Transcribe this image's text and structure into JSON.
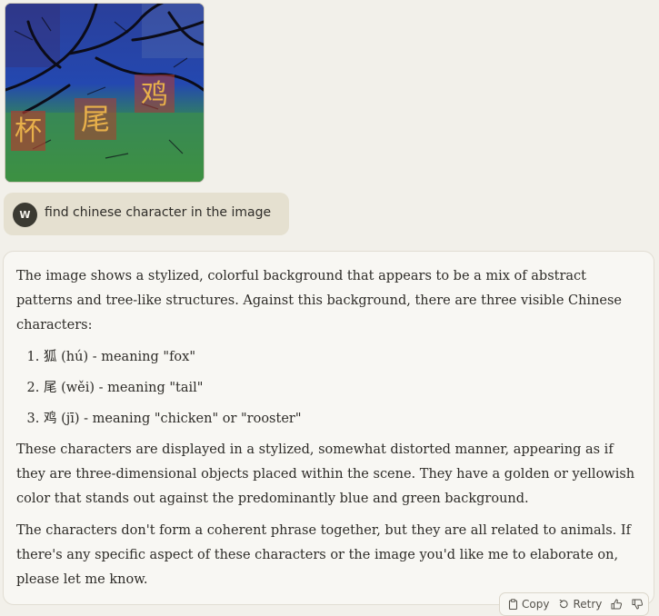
{
  "attachment": {
    "characters": [
      "杯",
      "尾",
      "鸡"
    ]
  },
  "user": {
    "avatar_initial": "W",
    "message": "find chinese character in the image"
  },
  "assistant": {
    "p1": "The image shows a stylized, colorful background that appears to be a mix of abstract patterns and tree-like structures. Against this background, there are three visible Chinese characters:",
    "list": [
      "狐 (hú) - meaning \"fox\"",
      "尾 (wěi) - meaning \"tail\"",
      "鸡 (jī) - meaning \"chicken\" or \"rooster\""
    ],
    "p2": "These characters are displayed in a stylized, somewhat distorted manner, appearing as if they are three-dimensional objects placed within the scene. They have a golden or yellowish color that stands out against the predominantly blue and green background.",
    "p3": "The characters don't form a coherent phrase together, but they are all related to animals. If there's any specific aspect of these characters or the image you'd like me to elaborate on, please let me know."
  },
  "actions": {
    "copy": "Copy",
    "retry": "Retry",
    "icons": [
      "clipboard-icon",
      "retry-icon",
      "thumbs-up-icon",
      "thumbs-down-icon"
    ]
  },
  "colors": {
    "page_bg": "#f2f0ea",
    "user_bubble": "#e5e0d0",
    "avatar": "#3b3a32",
    "character_gold": "#e8b04a"
  }
}
